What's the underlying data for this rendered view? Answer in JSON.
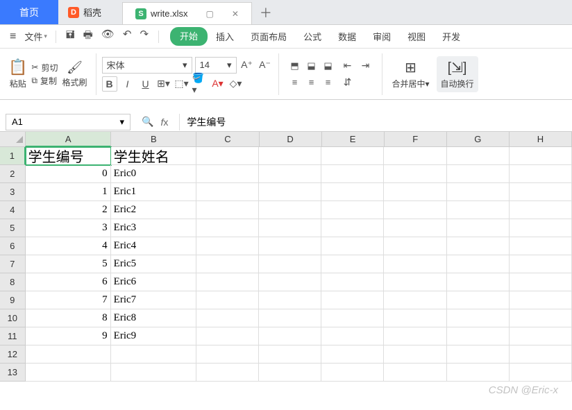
{
  "tabs": {
    "home": "首页",
    "docer": "稻壳",
    "file": "write.xlsx"
  },
  "menu": {
    "file": "文件",
    "items": [
      "开始",
      "插入",
      "页面布局",
      "公式",
      "数据",
      "审阅",
      "视图",
      "开发"
    ]
  },
  "ribbon": {
    "paste": "粘贴",
    "cut": "剪切",
    "copy": "复制",
    "format_painter": "格式刷",
    "font_name": "宋体",
    "font_size": "14",
    "merge": "合并居中",
    "wrap": "自动换行"
  },
  "namebox": "A1",
  "formula": "学生编号",
  "columns": [
    "A",
    "B",
    "C",
    "D",
    "E",
    "F",
    "G",
    "H"
  ],
  "sheet": {
    "headers": [
      "学生编号",
      "学生姓名"
    ],
    "rows": [
      {
        "id": "0",
        "name": "Eric0"
      },
      {
        "id": "1",
        "name": "Eric1"
      },
      {
        "id": "2",
        "name": "Eric2"
      },
      {
        "id": "3",
        "name": "Eric3"
      },
      {
        "id": "4",
        "name": "Eric4"
      },
      {
        "id": "5",
        "name": "Eric5"
      },
      {
        "id": "6",
        "name": "Eric6"
      },
      {
        "id": "7",
        "name": "Eric7"
      },
      {
        "id": "8",
        "name": "Eric8"
      },
      {
        "id": "9",
        "name": "Eric9"
      }
    ]
  },
  "watermark": "CSDN @Eric-x",
  "icons": {
    "docer": "D",
    "xlsx": "S"
  }
}
